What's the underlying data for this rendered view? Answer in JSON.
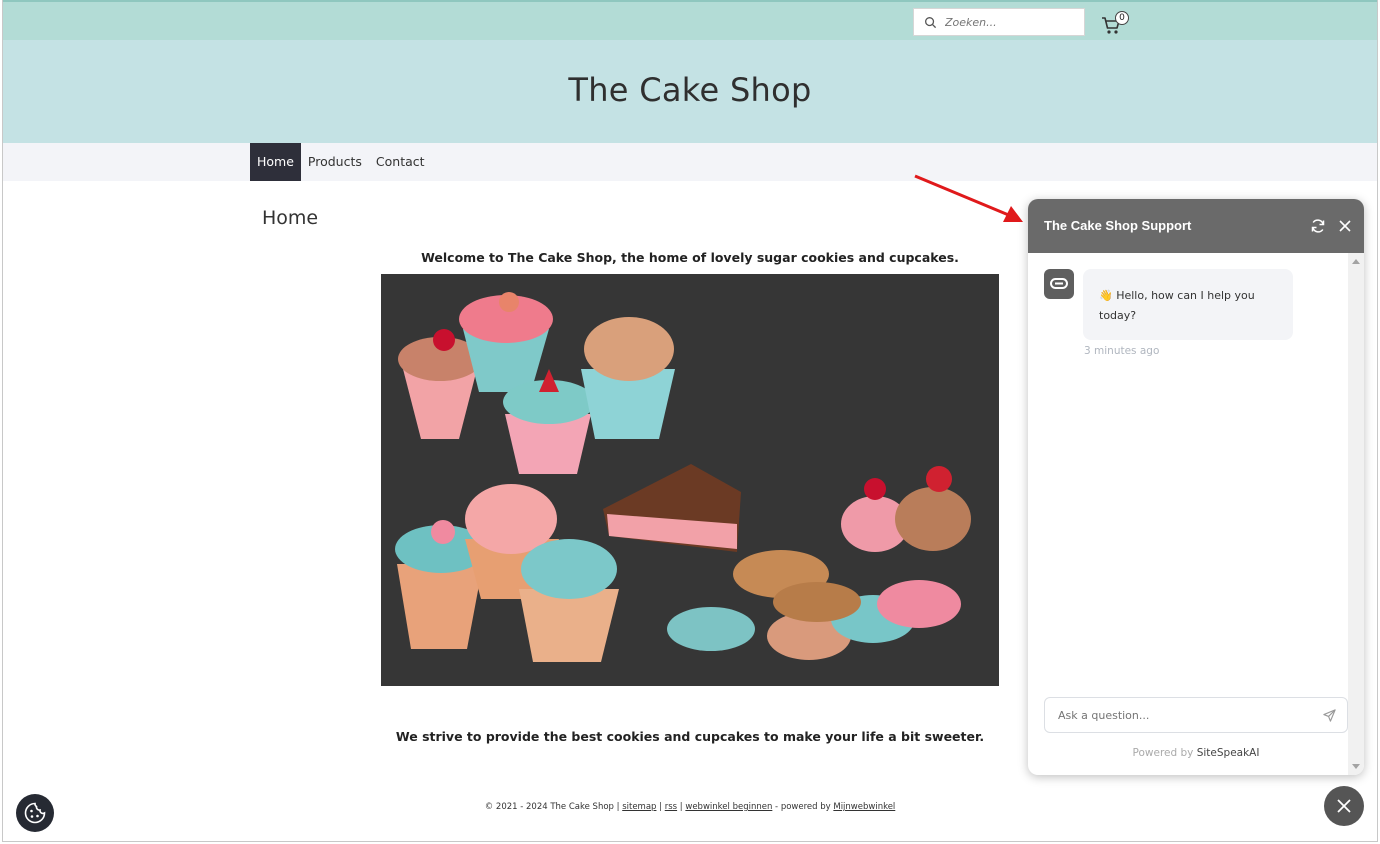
{
  "search": {
    "placeholder": "Zoeken..."
  },
  "cart": {
    "count": "0"
  },
  "site": {
    "title": "The Cake Shop"
  },
  "nav": {
    "items": [
      {
        "label": "Home",
        "active": true
      },
      {
        "label": "Products",
        "active": false
      },
      {
        "label": "Contact",
        "active": false
      }
    ]
  },
  "main": {
    "heading": "Home",
    "welcome": "Welcome to The Cake Shop, the home of lovely sugar cookies and cupcakes.",
    "strive": "We strive to provide the best cookies and cupcakes to make your life a bit sweeter."
  },
  "footer": {
    "copyright": "© 2021 - 2024 The Cake Shop | ",
    "sitemap": "sitemap",
    "sep1": " | ",
    "rss": "rss",
    "sep2": " | ",
    "webwinkel": "webwinkel beginnen",
    "powered": " - powered by ",
    "mijnwebwinkel": "Mijnwebwinkel"
  },
  "chat": {
    "title": "The Cake Shop Support",
    "message_emoji": "👋",
    "message": " Hello, how can I help you today?",
    "timestamp": "3 minutes ago",
    "input_placeholder": "Ask a question...",
    "powered_by": "Powered by ",
    "brand": "SiteSpeakAI"
  },
  "colors": {
    "topbar": "#b3dcd6",
    "header": "#c4e2e4",
    "nav_bg": "#f3f4f8",
    "nav_active": "#2e2f3a",
    "chat_header": "#6a6a6a",
    "arrow": "#e0191b"
  },
  "icons": [
    "search-icon",
    "cart-icon",
    "refresh-icon",
    "close-icon",
    "send-icon",
    "bot-avatar-icon",
    "cookie-icon",
    "close-chat-icon"
  ]
}
